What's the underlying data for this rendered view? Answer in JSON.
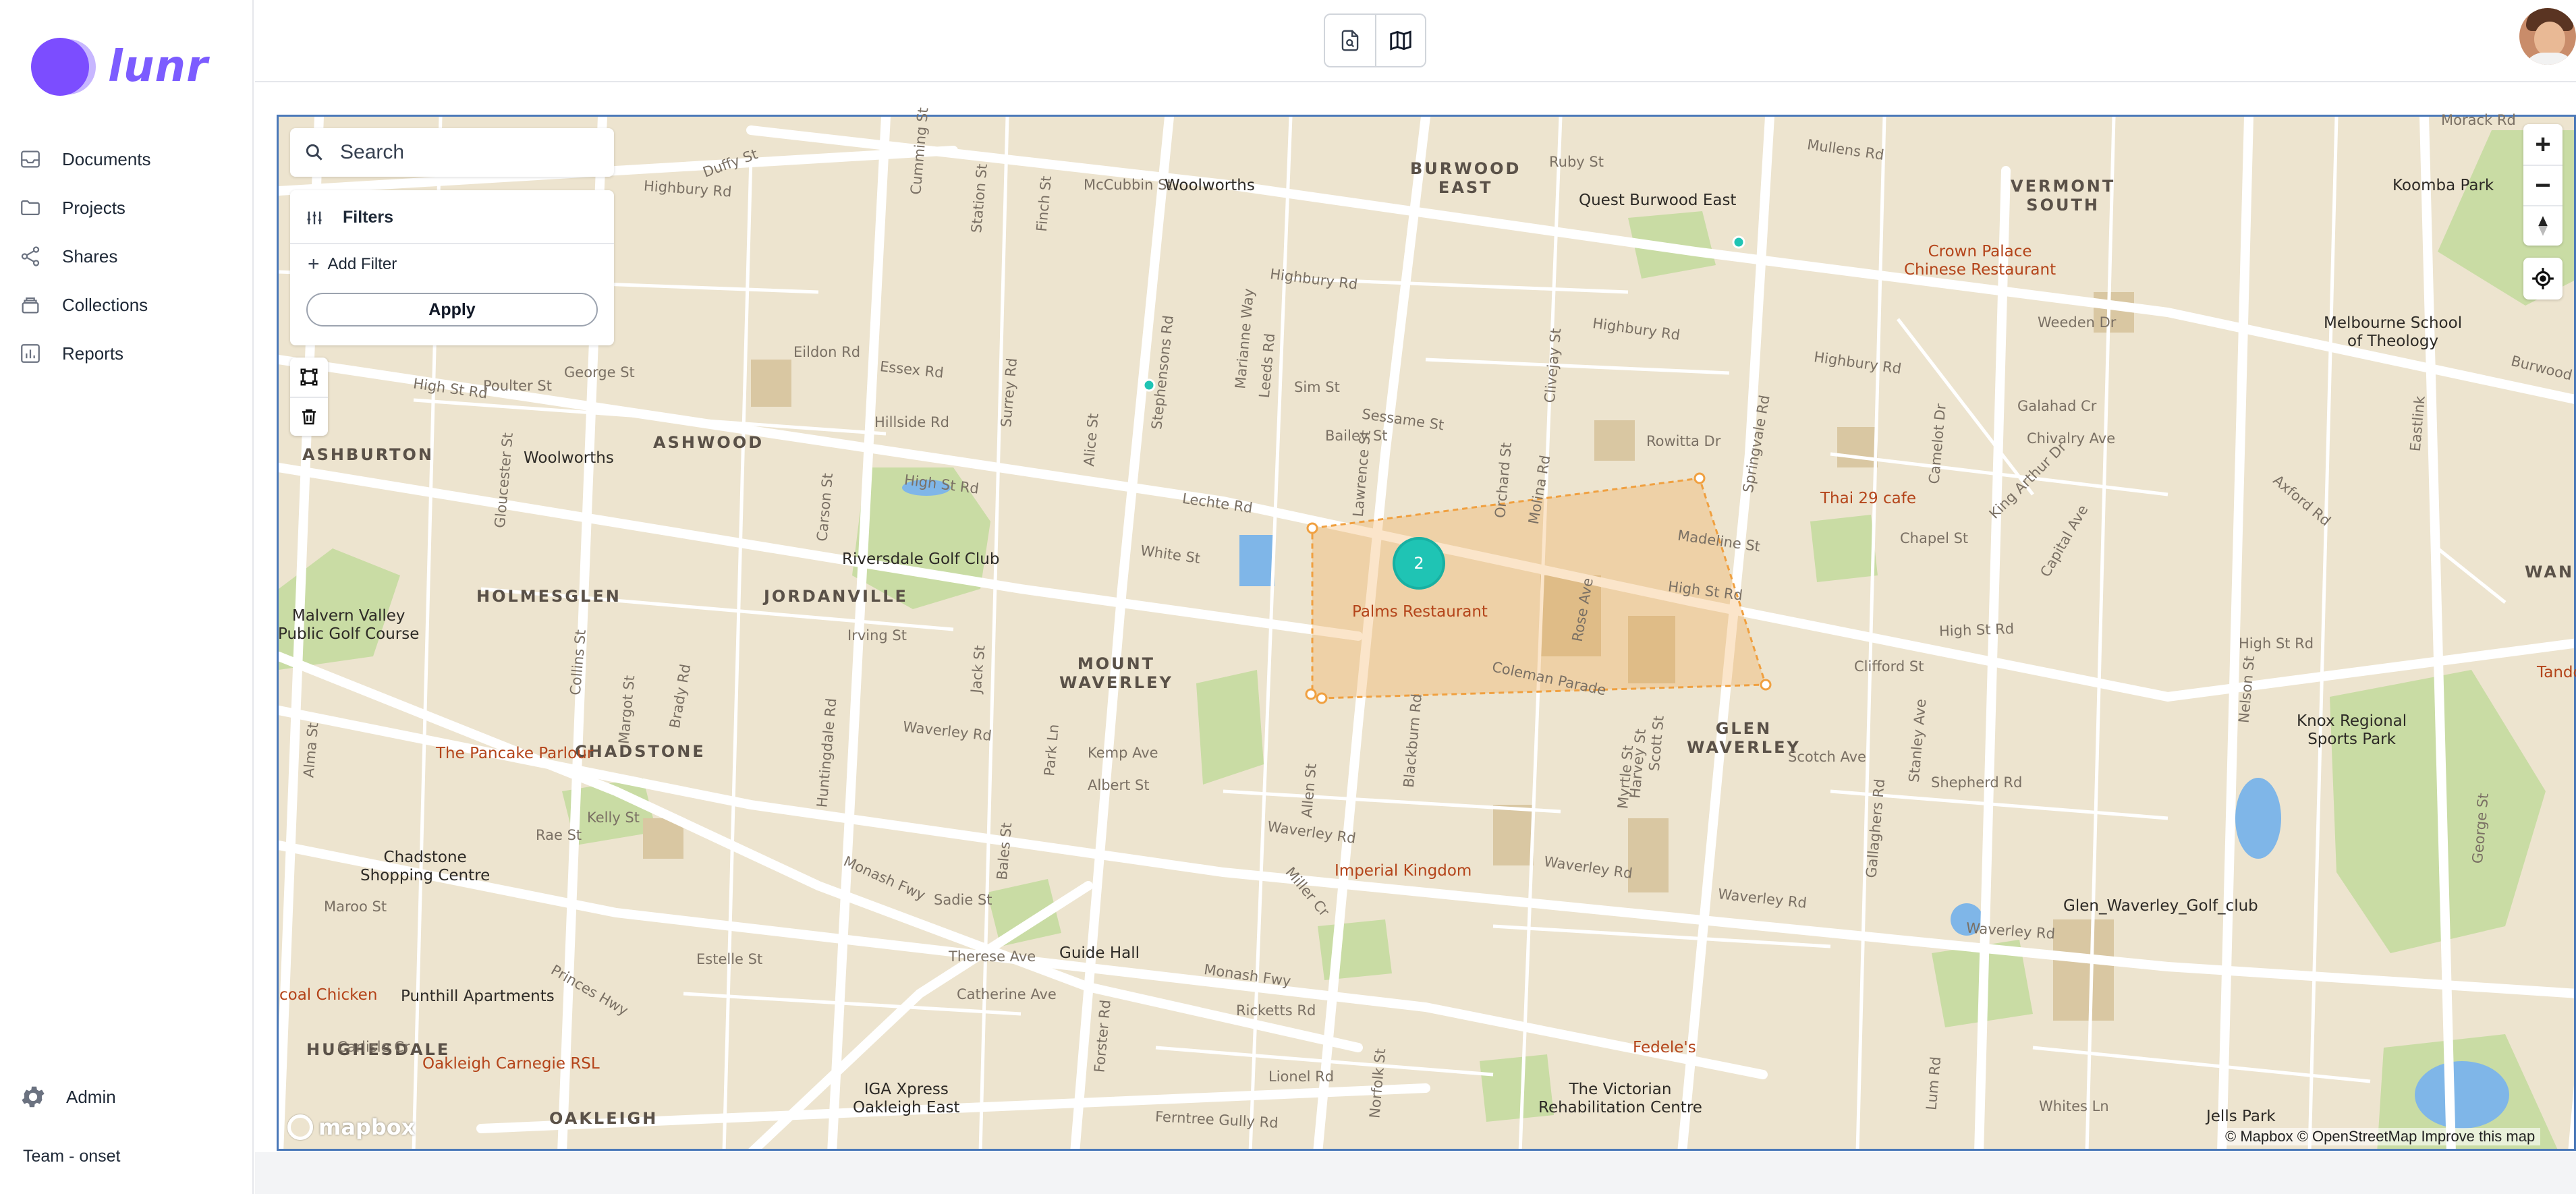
{
  "app": {
    "name": "lunr",
    "brand_color": "#7c4dff"
  },
  "sidebar": {
    "items": [
      {
        "label": "Documents",
        "icon": "inbox-icon"
      },
      {
        "label": "Projects",
        "icon": "folder-icon"
      },
      {
        "label": "Shares",
        "icon": "share-icon"
      },
      {
        "label": "Collections",
        "icon": "collection-icon"
      },
      {
        "label": "Reports",
        "icon": "bar-chart-icon"
      }
    ],
    "admin_label": "Admin",
    "team_label": "Team - onset"
  },
  "topbar": {
    "views": [
      {
        "name": "document-search-view",
        "icon": "document-search-icon"
      },
      {
        "name": "map-view",
        "icon": "map-icon"
      }
    ]
  },
  "search": {
    "placeholder": "Search"
  },
  "filters": {
    "title": "Filters",
    "add_filter_label": "Add Filter",
    "apply_label": "Apply"
  },
  "zoom": {
    "in_label": "+",
    "out_label": "−"
  },
  "map": {
    "cluster_count": "2",
    "attribution": "© Mapbox © OpenStreetMap Improve this map",
    "logo_text": "mapbox",
    "selection_color": "#f0a040",
    "marker_color": "#1fc4b4",
    "suburbs": [
      {
        "name": "BURWOOD\nEAST"
      },
      {
        "name": "VERMONT\nSOUTH"
      },
      {
        "name": "ASHBURTON"
      },
      {
        "name": "ASHWOOD"
      },
      {
        "name": "HOLMESGLEN"
      },
      {
        "name": "JORDANVILLE"
      },
      {
        "name": "MOUNT\nWAVERLEY"
      },
      {
        "name": "CHADSTONE"
      },
      {
        "name": "GLEN\nWAVERLEY"
      },
      {
        "name": "HUGHESDALE"
      },
      {
        "name": "OAKLEIGH"
      },
      {
        "name": "WAN"
      }
    ],
    "places": [
      {
        "name": "Woolworths"
      },
      {
        "name": "Quest Burwood East"
      },
      {
        "name": "Koomba Park"
      },
      {
        "name": "Melbourne School\nof Theology"
      },
      {
        "name": "Woolworths"
      },
      {
        "name": "Riversdale Golf Club"
      },
      {
        "name": "Malvern Valley\nPublic Golf Course"
      },
      {
        "name": "Knox Regional\nSports Park"
      },
      {
        "name": "Chadstone\nShopping Centre"
      },
      {
        "name": "Guide Hall"
      },
      {
        "name": "Glen_Waverley_Golf_club"
      },
      {
        "name": "Punthill Apartments"
      },
      {
        "name": "IGA Xpress\nOakleigh East"
      },
      {
        "name": "The Victorian\nRehabilitation Centre"
      },
      {
        "name": "Jells Park"
      }
    ],
    "restaurants": [
      {
        "name": "Crown Palace\nChinese Restaurant"
      },
      {
        "name": "Thai 29 cafe"
      },
      {
        "name": "Palms Restaurant"
      },
      {
        "name": "Tandoor"
      },
      {
        "name": "The Pancake Parlour"
      },
      {
        "name": "Imperial Kingdom"
      },
      {
        "name": "coal Chicken"
      },
      {
        "name": "Oakleigh Carnegie RSL"
      },
      {
        "name": "Fedele's"
      }
    ],
    "roads": [
      {
        "name": "Highbury Rd"
      },
      {
        "name": "Highbury Rd"
      },
      {
        "name": "Highbury Rd"
      },
      {
        "name": "Highbury Rd"
      },
      {
        "name": "High St Rd"
      },
      {
        "name": "High St Rd"
      },
      {
        "name": "High St Rd"
      },
      {
        "name": "High St Rd"
      },
      {
        "name": "High St Rd"
      },
      {
        "name": "Waverley Rd"
      },
      {
        "name": "Waverley Rd"
      },
      {
        "name": "Waverley Rd"
      },
      {
        "name": "Waverley Rd"
      },
      {
        "name": "Waverley Rd"
      },
      {
        "name": "Monash Fwy"
      },
      {
        "name": "Monash Fwy"
      },
      {
        "name": "Ferntree Gully Rd"
      },
      {
        "name": "Princes Hwy"
      },
      {
        "name": "Springvale Rd"
      },
      {
        "name": "Blackburn Rd"
      },
      {
        "name": "Stephensons Rd"
      },
      {
        "name": "Huntingdale Rd"
      },
      {
        "name": "Coleman Parade"
      },
      {
        "name": "Essex Rd"
      },
      {
        "name": "Sim St"
      },
      {
        "name": "Sessame St"
      },
      {
        "name": "Lechte Rd"
      },
      {
        "name": "White St"
      },
      {
        "name": "Kemp Ave"
      },
      {
        "name": "Albert St"
      },
      {
        "name": "Madeline St"
      },
      {
        "name": "Rowitta Dr"
      },
      {
        "name": "Clifford St"
      },
      {
        "name": "Shepherd Rd"
      },
      {
        "name": "Burwood Hwy"
      },
      {
        "name": "Morack Rd"
      },
      {
        "name": "Mullens Rd"
      },
      {
        "name": "Weeden Dr"
      },
      {
        "name": "Galahad Cr"
      },
      {
        "name": "Chivalry Ave"
      },
      {
        "name": "Chapel St"
      },
      {
        "name": "Eastlink"
      },
      {
        "name": "George St"
      },
      {
        "name": "Duffy St"
      },
      {
        "name": "Poulter St"
      },
      {
        "name": "George St"
      },
      {
        "name": "Eildon Rd"
      },
      {
        "name": "Hillside Rd"
      },
      {
        "name": "Estelle St"
      },
      {
        "name": "Sadie St"
      },
      {
        "name": "Therese Ave"
      },
      {
        "name": "Catherine Ave"
      },
      {
        "name": "Ricketts Rd"
      },
      {
        "name": "Lionel Rd"
      },
      {
        "name": "Whites Ln"
      },
      {
        "name": "Rae St"
      },
      {
        "name": "Maroo St"
      },
      {
        "name": "Carlisle Cr"
      },
      {
        "name": "Kelly St"
      },
      {
        "name": "Irving St"
      },
      {
        "name": "Gallaghers Rd"
      },
      {
        "name": "Camelot Dr"
      },
      {
        "name": "Lum Rd"
      },
      {
        "name": "Norfolk St"
      },
      {
        "name": "Forster Rd"
      },
      {
        "name": "Miller Cr"
      },
      {
        "name": "Nelson St"
      },
      {
        "name": "Harvey St"
      },
      {
        "name": "Alma St"
      },
      {
        "name": "Collins St"
      },
      {
        "name": "McCubbin St"
      },
      {
        "name": "Station St"
      },
      {
        "name": "Cumming St"
      },
      {
        "name": "Finch St"
      },
      {
        "name": "Ruby St"
      },
      {
        "name": "Marianne Way"
      },
      {
        "name": "Leeds Rd"
      },
      {
        "name": "Lawrence St"
      },
      {
        "name": "Bailey St"
      },
      {
        "name": "Clivejay St"
      },
      {
        "name": "Orchard St"
      },
      {
        "name": "Molina Rd"
      },
      {
        "name": "Rose Ave"
      },
      {
        "name": "Myrtle St"
      },
      {
        "name": "Park Ln"
      },
      {
        "name": "Bales St"
      },
      {
        "name": "Axford Rd"
      },
      {
        "name": "Capital Ave"
      },
      {
        "name": "King Arthur Dr"
      },
      {
        "name": "Alice St"
      },
      {
        "name": "Surrey Rd"
      },
      {
        "name": "Gloucester St"
      },
      {
        "name": "Margot St"
      },
      {
        "name": "Brady Rd"
      },
      {
        "name": "Jack St"
      },
      {
        "name": "Allen St"
      },
      {
        "name": "Carson St"
      },
      {
        "name": "Scott St"
      },
      {
        "name": "Scotch Ave"
      },
      {
        "name": "Stanley Ave"
      }
    ]
  }
}
